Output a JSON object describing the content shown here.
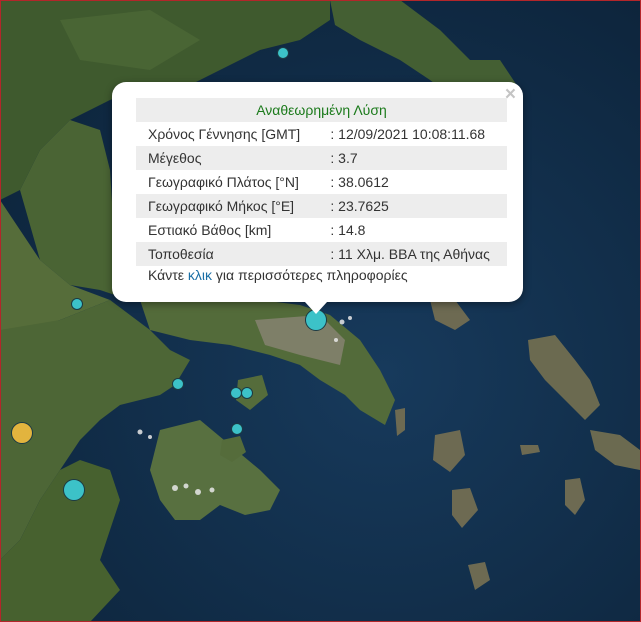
{
  "popup": {
    "header": "Αναθεωρημένη Λύση",
    "close_symbol": "×",
    "rows": [
      {
        "label": "Χρόνος Γέννησης [GMT]",
        "value": ": 12/09/2021 10:08:11.68"
      },
      {
        "label": "Μέγεθος",
        "value": ": 3.7"
      },
      {
        "label": "Γεωγραφικό Πλάτος [°N]",
        "value": ": 38.0612"
      },
      {
        "label": "Γεωγραφικό Μήκος [°E]",
        "value": ": 23.7625"
      },
      {
        "label": "Εστιακό Βάθος [km]",
        "value": ": 14.8"
      },
      {
        "label": "Τοποθεσία",
        "value": ": 11 Χλμ. ΒΒΑ της Αθήνας"
      }
    ],
    "more_prefix": "Κάντε ",
    "more_link": "κλικ",
    "more_suffix": " για περισσότερες πληροφορίες"
  },
  "colors": {
    "sea": "#0f2a45",
    "land": "#3f5a2e",
    "quake_marker": "#3cc2c8",
    "quake_marker_older": "#e2b43e",
    "header_text": "#1b7a1b",
    "link": "#1a6fa6"
  }
}
